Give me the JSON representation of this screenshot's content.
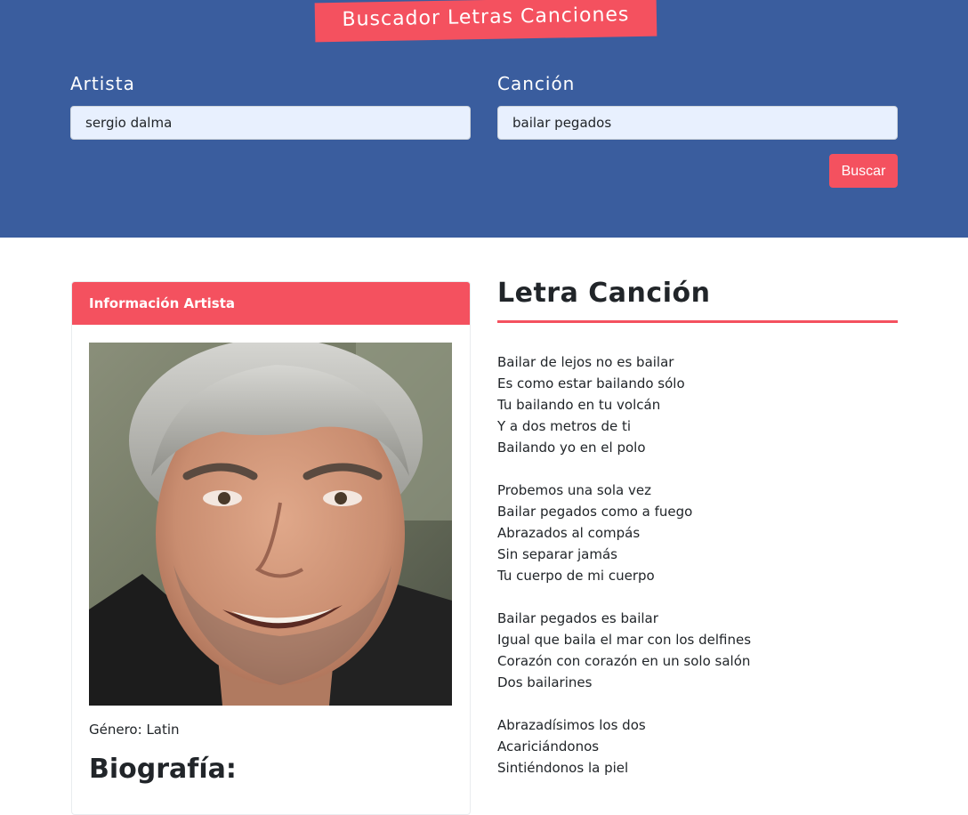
{
  "header": {
    "title": "Buscador Letras Canciones",
    "artist_label": "Artista",
    "artist_value": "sergio dalma",
    "song_label": "Canción",
    "song_value": "bailar pegados",
    "search_button": "Buscar"
  },
  "artist_card": {
    "header": "Información Artista",
    "genre_label": "Género:",
    "genre_value": "Latin",
    "bio_title": "Biografía:"
  },
  "lyrics": {
    "title": "Letra Canción",
    "stanzas": [
      [
        "Bailar de lejos no es bailar",
        "Es como estar bailando sólo",
        "Tu bailando en tu volcán",
        "Y a dos metros de ti",
        "Bailando yo en el polo"
      ],
      [
        "Probemos una sola vez",
        "Bailar pegados como a fuego",
        "Abrazados al compás",
        "Sin separar jamás",
        "Tu cuerpo de mi cuerpo"
      ],
      [
        "Bailar pegados es bailar",
        "Igual que baila el mar con los delfines",
        "Corazón con corazón en un solo salón",
        "Dos bailarines"
      ],
      [
        "Abrazadísimos los dos",
        "Acariciándonos",
        "Sintiéndonos la piel"
      ]
    ]
  },
  "colors": {
    "header_bg": "#3a5d9e",
    "accent": "#f4515f",
    "input_bg": "#e8f0fe"
  }
}
